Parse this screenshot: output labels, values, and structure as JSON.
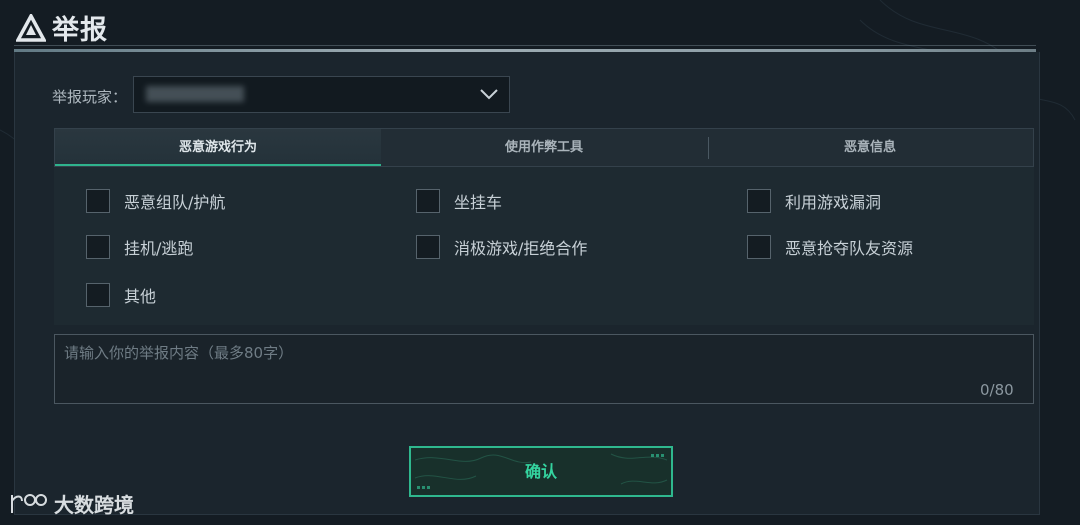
{
  "title": "举报",
  "title_icon": "warning-triangle-icon",
  "player": {
    "label": "举报玩家：",
    "value": "▪▪▪▪▪▪▪",
    "dropdown_icon": "chevron-down-icon"
  },
  "tabs": [
    {
      "label": "恶意游戏行为",
      "active": true
    },
    {
      "label": "使用作弊工具",
      "active": false
    },
    {
      "label": "恶意信息",
      "active": false
    }
  ],
  "options": [
    {
      "label": "恶意组队/护航",
      "checked": false
    },
    {
      "label": "坐挂车",
      "checked": false
    },
    {
      "label": "利用游戏漏洞",
      "checked": false
    },
    {
      "label": "挂机/逃跑",
      "checked": false
    },
    {
      "label": "消极游戏/拒绝合作",
      "checked": false
    },
    {
      "label": "恶意抢夺队友资源",
      "checked": false
    },
    {
      "label": "其他",
      "checked": false
    }
  ],
  "content": {
    "placeholder": "请输入你的举报内容（最多80字）",
    "value": "",
    "counter": "0/80"
  },
  "confirm_label": "确认",
  "watermark": "大数跨境",
  "colors": {
    "accent": "#2fb88e",
    "background": "#141c23",
    "panel": "#1b252d"
  }
}
